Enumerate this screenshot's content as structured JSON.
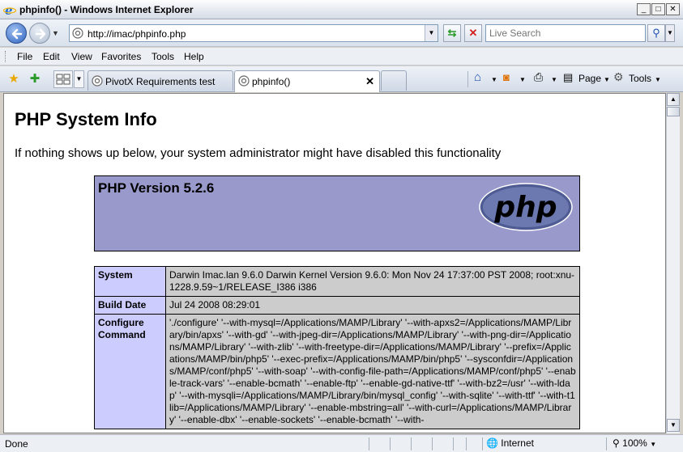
{
  "window": {
    "title": "phpinfo() - Windows Internet Explorer",
    "minimize": "_",
    "maximize": "□",
    "close": "✕"
  },
  "address_bar": {
    "url": "http://imac/phpinfo.php",
    "search_placeholder": "Live Search"
  },
  "menu": [
    "File",
    "Edit",
    "View",
    "Favorites",
    "Tools",
    "Help"
  ],
  "tabs": [
    {
      "label": "PivotX Requirements test",
      "active": false
    },
    {
      "label": "phpinfo()",
      "active": true,
      "close": "✕"
    }
  ],
  "command_bar": {
    "page_label": "Page",
    "tools_label": "Tools"
  },
  "page": {
    "heading": "PHP System Info",
    "message": "If nothing shows up below, your system administrator might have disabled this functionality",
    "version_title": "PHP Version 5.2.6",
    "logo_text": "php",
    "rows": [
      {
        "key": "System",
        "value": "Darwin Imac.lan 9.6.0 Darwin Kernel Version 9.6.0: Mon Nov 24 17:37:00 PST 2008; root:xnu-1228.9.59~1/RELEASE_I386 i386"
      },
      {
        "key": "Build Date",
        "value": "Jul 24 2008 08:29:01"
      },
      {
        "key": "Configure Command",
        "value": "'./configure' '--with-mysql=/Applications/MAMP/Library' '--with-apxs2=/Applications/MAMP/Library/bin/apxs' '--with-gd' '--with-jpeg-dir=/Applications/MAMP/Library' '--with-png-dir=/Applications/MAMP/Library' '--with-zlib' '--with-freetype-dir=/Applications/MAMP/Library' '--prefix=/Applications/MAMP/bin/php5' '--exec-prefix=/Applications/MAMP/bin/php5' '--sysconfdir=/Applications/MAMP/conf/php5' '--with-soap' '--with-config-file-path=/Applications/MAMP/conf/php5' '--enable-track-vars' '--enable-bcmath' '--enable-ftp' '--enable-gd-native-ttf' '--with-bz2=/usr' '--with-ldap' '--with-mysqli=/Applications/MAMP/Library/bin/mysql_config' '--with-sqlite' '--with-ttf' '--with-t1lib=/Applications/MAMP/Library' '--enable-mbstring=all' '--with-curl=/Applications/MAMP/Library' '--enable-dbx' '--enable-sockets' '--enable-bcmath' '--with-"
      }
    ]
  },
  "status_bar": {
    "status": "Done",
    "zone": "Internet",
    "zoom": "100%"
  }
}
